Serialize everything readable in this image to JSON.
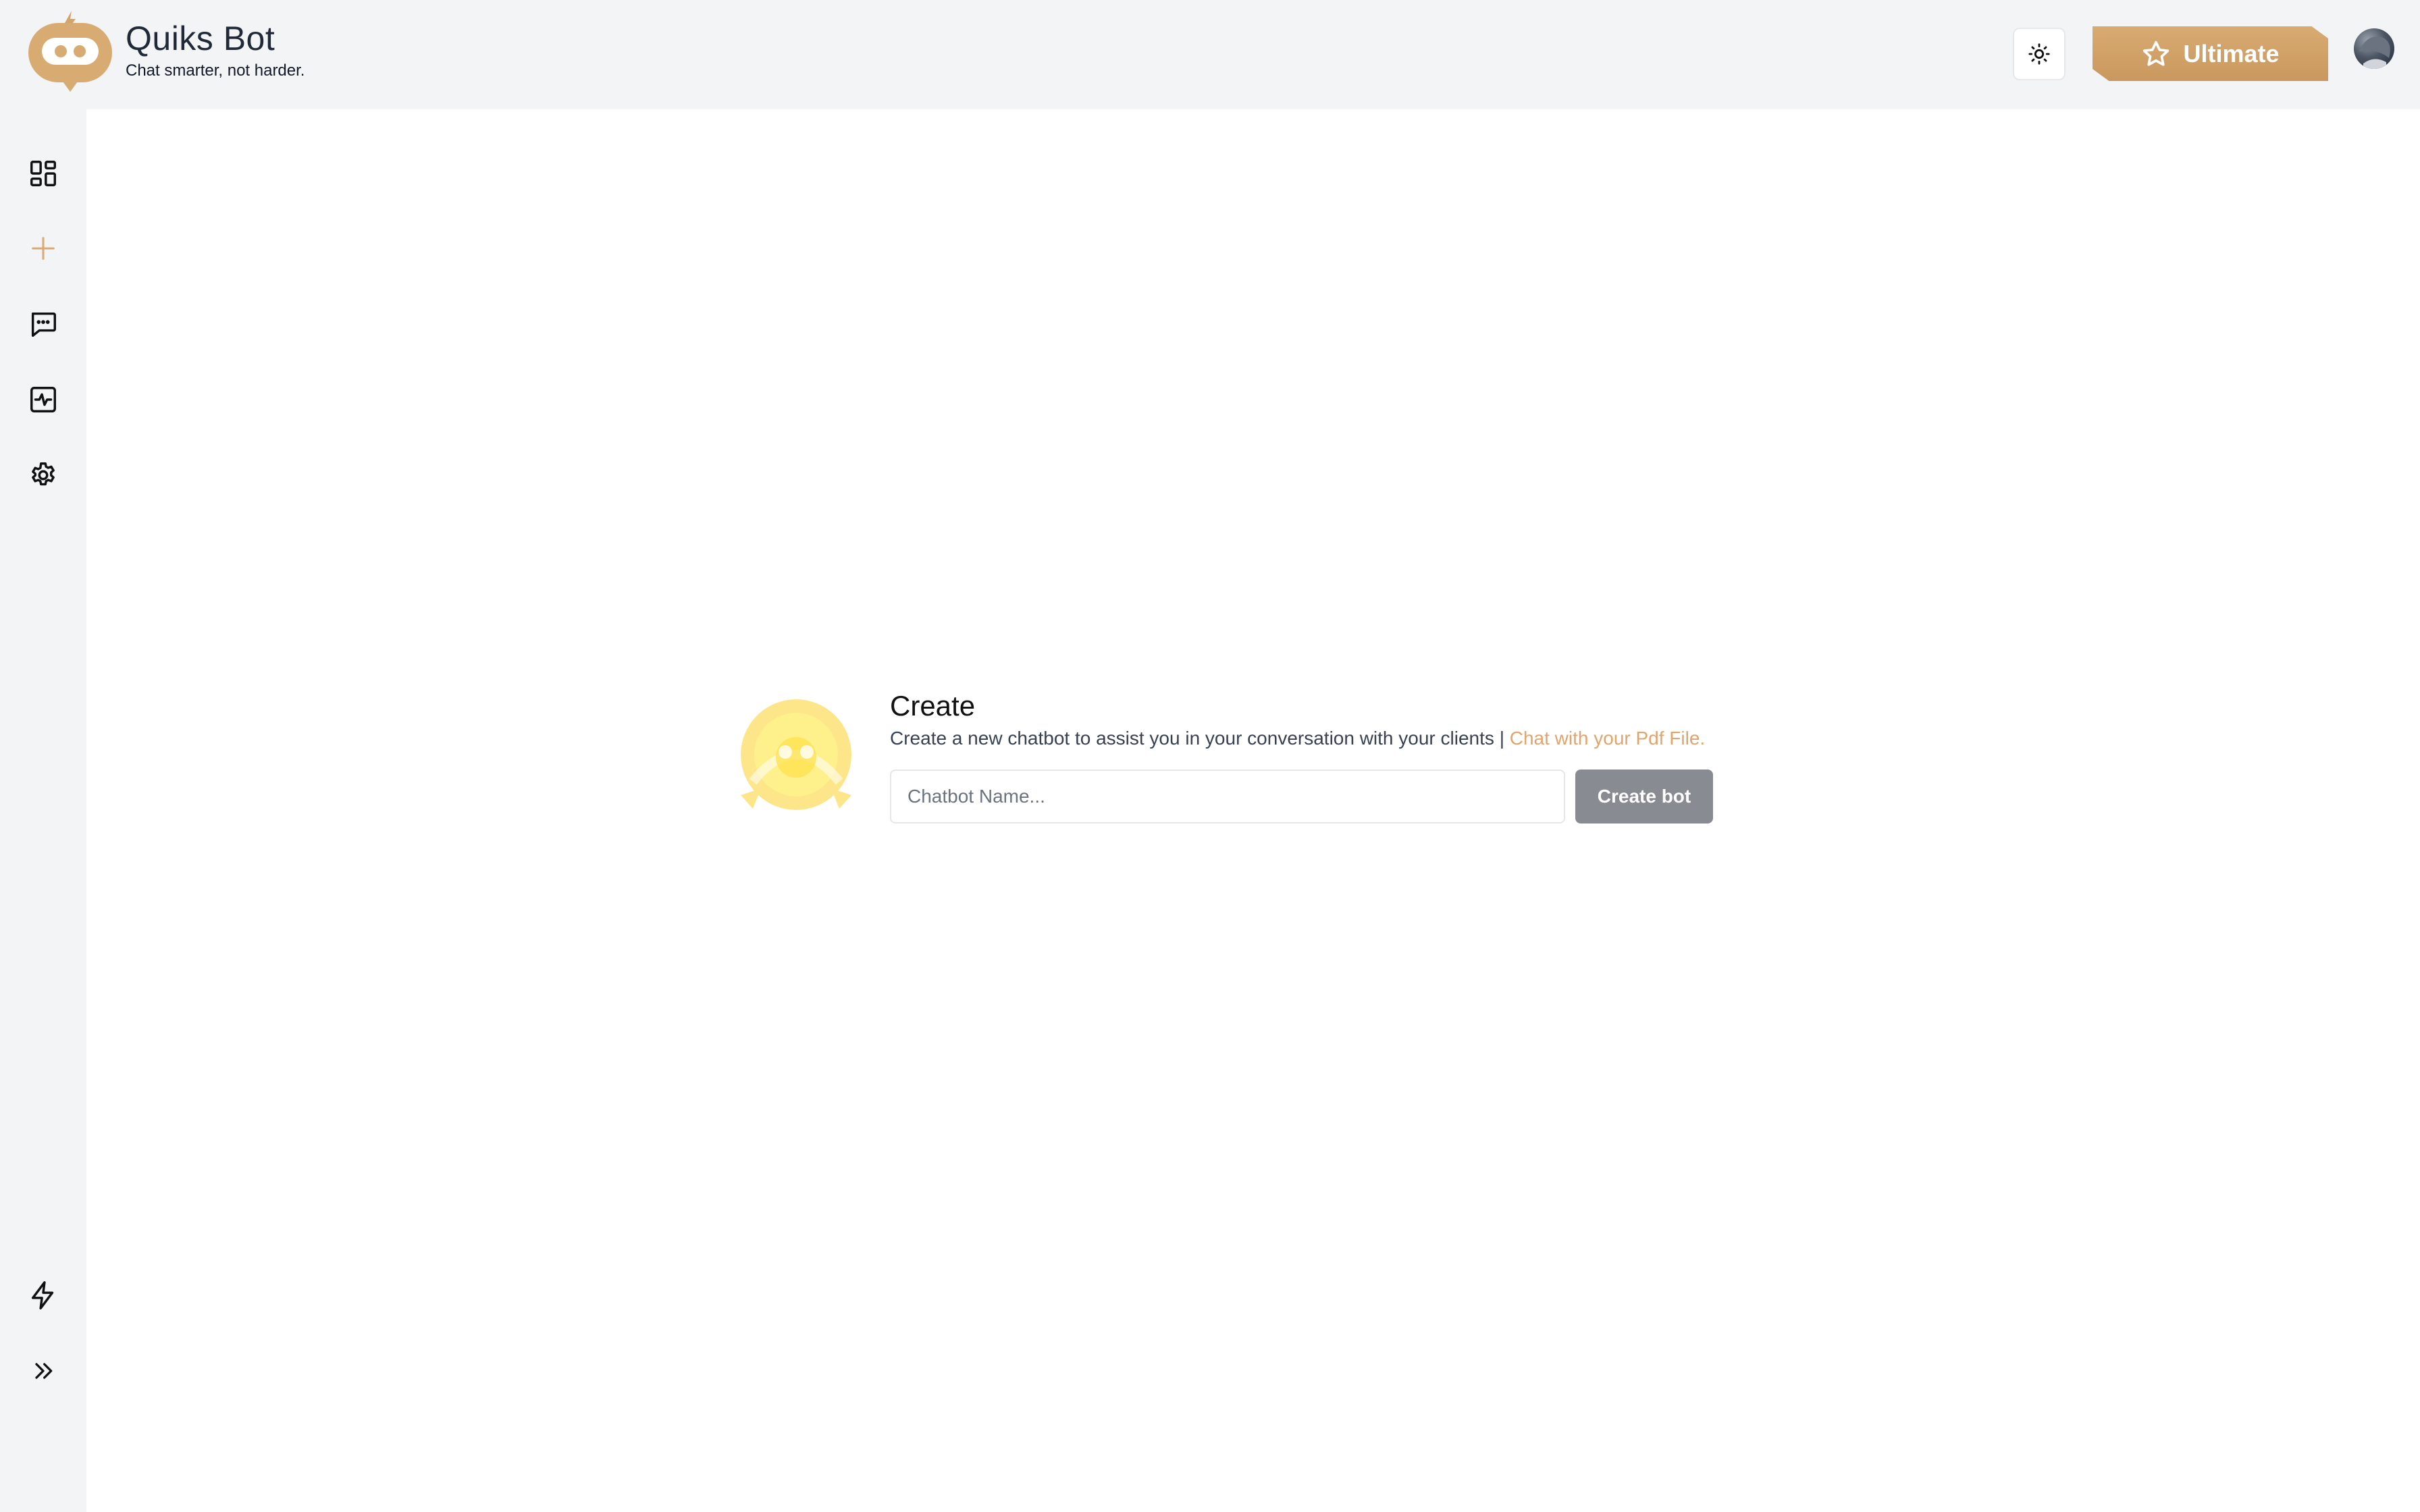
{
  "brand": {
    "title": "Quiks Bot",
    "tagline": "Chat smarter, not harder.",
    "logo_icon": "robot-logo-icon",
    "accent_color": "#d8ab72"
  },
  "header": {
    "theme_toggle_icon": "sun-icon",
    "ultimate_label": "Ultimate",
    "ultimate_icon": "star-icon",
    "avatar_icon": "user-avatar"
  },
  "sidebar": {
    "items": [
      {
        "name": "dashboard",
        "icon": "dashboard-grid-icon"
      },
      {
        "name": "create",
        "icon": "plus-icon",
        "active": true
      },
      {
        "name": "chats",
        "icon": "chat-bubble-icon"
      },
      {
        "name": "analytics",
        "icon": "activity-icon"
      },
      {
        "name": "settings",
        "icon": "gear-icon"
      },
      {
        "name": "upgrade",
        "icon": "lightning-icon"
      },
      {
        "name": "expand",
        "icon": "double-chevron-right-icon"
      }
    ]
  },
  "create": {
    "title": "Create",
    "description": "Create a new chatbot to assist you in your conversation with your clients",
    "separator": "|",
    "pdf_link": "Chat with your Pdf File.",
    "input_placeholder": "Chatbot Name...",
    "input_value": "",
    "button_label": "Create bot"
  }
}
